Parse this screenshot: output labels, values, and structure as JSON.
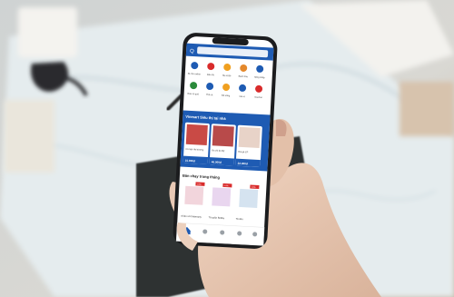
{
  "photo": {
    "colors": {
      "background": "#d9d8d3",
      "map_paper": "#e6edf0",
      "notebook": "#2f3133",
      "phone_frame": "#1b1c1e",
      "skin": "#e7c8b3",
      "app_blue": "#1e5bb3",
      "accent_red": "#d92b2b"
    }
  },
  "app": {
    "header_title": "Q",
    "categories_row1": [
      "Đi chợ online",
      "Siêu thị",
      "Mẹ & Bé",
      "Bách hóa",
      "Hàng nhập"
    ],
    "categories_row2": [
      "Rau củ quả",
      "Thịt cá",
      "Đồ uống",
      "Gia vị",
      "Voucher"
    ],
    "promo_banner_title": "Vinmart Siêu thị tại nhà",
    "flash_sale_products": [
      {
        "name": "Cá ngừ đại dương",
        "price": "31.900đ"
      },
      {
        "name": "Ba chỉ bò Mỹ",
        "price": "46.000đ"
      },
      {
        "name": "Đùi gà CP",
        "price": "22.900đ"
      }
    ],
    "bestseller_title": "Bán chạy trong tháng",
    "bestseller_products": [
      {
        "name": "Khăn ướt Mamamy",
        "badge": "-15%"
      },
      {
        "name": "Tã quần Bobby",
        "badge": "-10%"
      },
      {
        "name": "Tã dán",
        "badge": "-10%"
      }
    ],
    "bottom_nav_active": "Trang chủ"
  }
}
